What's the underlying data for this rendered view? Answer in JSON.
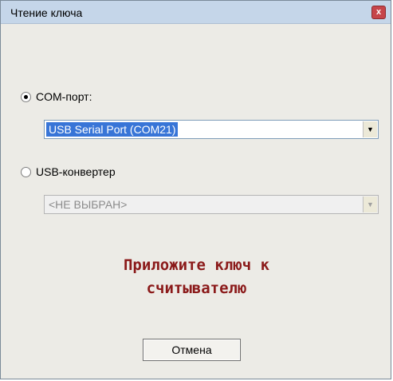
{
  "window": {
    "title": "Чтение ключа",
    "close_glyph": "x"
  },
  "options": [
    {
      "label": "COM-порт:",
      "selected": true
    },
    {
      "label": "USB-конвертер",
      "selected": false
    }
  ],
  "com_port_select": {
    "value": "USB Serial Port (COM21)",
    "enabled": true
  },
  "usb_converter_select": {
    "value": "<НЕ ВЫБРАН>",
    "enabled": false
  },
  "message": {
    "line1": "Приложите ключ к",
    "line2": "считывателю",
    "color": "#8b1a1a"
  },
  "buttons": {
    "cancel_label": "Отмена"
  },
  "icons": {
    "dropdown_arrow": "chevron-down-icon",
    "close": "close-icon"
  }
}
